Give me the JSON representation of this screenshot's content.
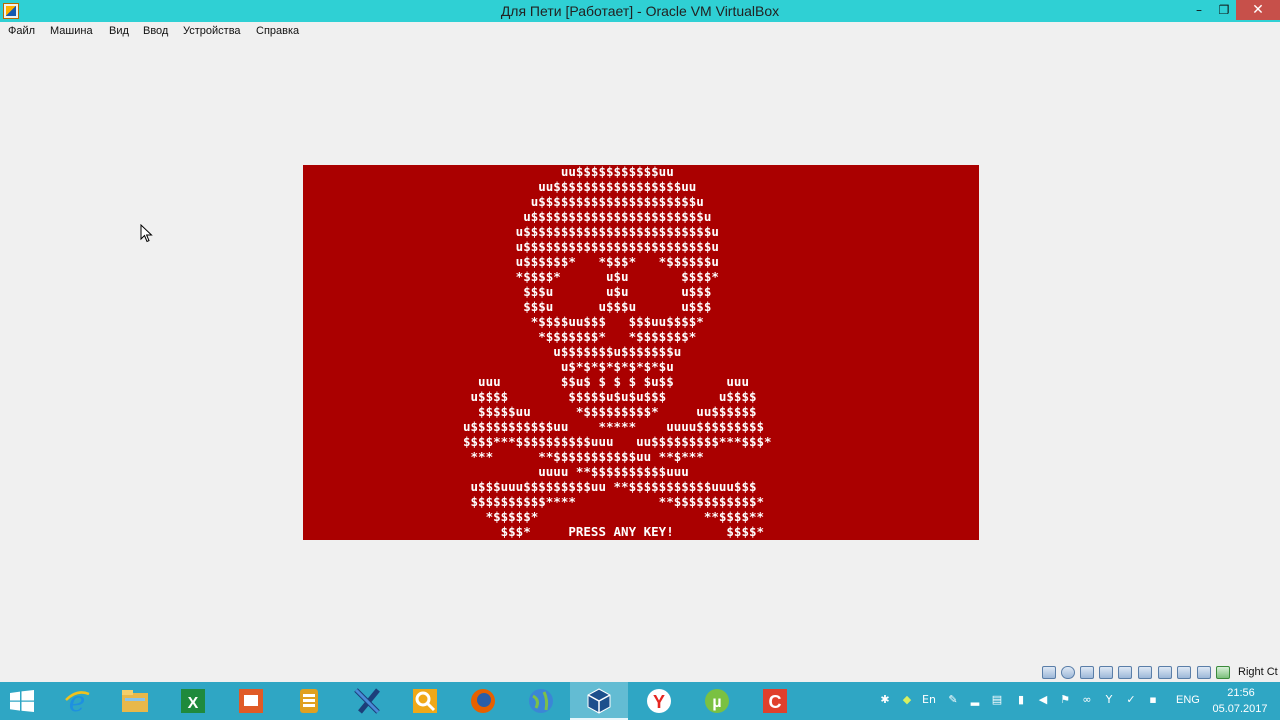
{
  "window": {
    "title": "Для Пети [Работает] - Oracle VM VirtualBox",
    "minimize_glyph": "–",
    "restore_glyph": "❐",
    "close_glyph": "✕"
  },
  "menu": {
    "items": [
      {
        "label": "Файл"
      },
      {
        "label": "Машина"
      },
      {
        "label": "Вид"
      },
      {
        "label": "Ввод"
      },
      {
        "label": "Устройства"
      },
      {
        "label": "Справка"
      }
    ]
  },
  "vm_screen": {
    "background": "#aa0000",
    "foreground": "#fefefe",
    "lines": [
      "             uu$$$$$$$$$$$uu",
      "          uu$$$$$$$$$$$$$$$$$uu",
      "         u$$$$$$$$$$$$$$$$$$$$$u",
      "        u$$$$$$$$$$$$$$$$$$$$$$$u",
      "       u$$$$$$$$$$$$$$$$$$$$$$$$$u",
      "       u$$$$$$$$$$$$$$$$$$$$$$$$$u",
      "       u$$$$$$*   *$$$*   *$$$$$$u",
      "       *$$$$*      u$u       $$$$*",
      "        $$$u       u$u       u$$$",
      "        $$$u      u$$$u      u$$$",
      "         *$$$$uu$$$   $$$uu$$$$*",
      "          *$$$$$$$*   *$$$$$$$*",
      "            u$$$$$$$u$$$$$$$u",
      "             u$*$*$*$*$*$*$u",
      "  uuu        $$u$ $ $ $ $u$$       uuu",
      " u$$$$        $$$$$u$u$u$$$       u$$$$",
      "  $$$$$uu      *$$$$$$$$$*     uu$$$$$$",
      "u$$$$$$$$$$$uu    *****    uuuu$$$$$$$$$",
      "$$$$***$$$$$$$$$$uuu   uu$$$$$$$$$***$$$*",
      " ***      **$$$$$$$$$$$uu **$***",
      "          uuuu **$$$$$$$$$$uuu",
      " u$$$uuu$$$$$$$$$uu **$$$$$$$$$$$uuu$$$",
      " $$$$$$$$$$****           **$$$$$$$$$$$*",
      "   *$$$$$*                      **$$$$**",
      "     $$$*     PRESS ANY KEY!       $$$$*"
    ]
  },
  "statusbar": {
    "host_key": "Right Ct"
  },
  "taskbar": {
    "apps": [
      {
        "icon": "windows-start-icon"
      },
      {
        "icon": "internet-explorer-icon"
      },
      {
        "icon": "file-explorer-icon"
      },
      {
        "icon": "excel-icon"
      },
      {
        "icon": "powerpoint-icon"
      },
      {
        "icon": "archive-icon"
      },
      {
        "icon": "visual-studio-icon"
      },
      {
        "icon": "search-app-icon"
      },
      {
        "icon": "firefox-icon"
      },
      {
        "icon": "globe-browser-icon"
      },
      {
        "icon": "virtualbox-icon"
      },
      {
        "icon": "yandex-browser-icon"
      },
      {
        "icon": "utorrent-icon"
      },
      {
        "icon": "ccleaner-icon"
      }
    ],
    "tray": {
      "language": "ENG",
      "time": "21:56",
      "date": "05.07.2017",
      "lang_small": "En"
    }
  }
}
